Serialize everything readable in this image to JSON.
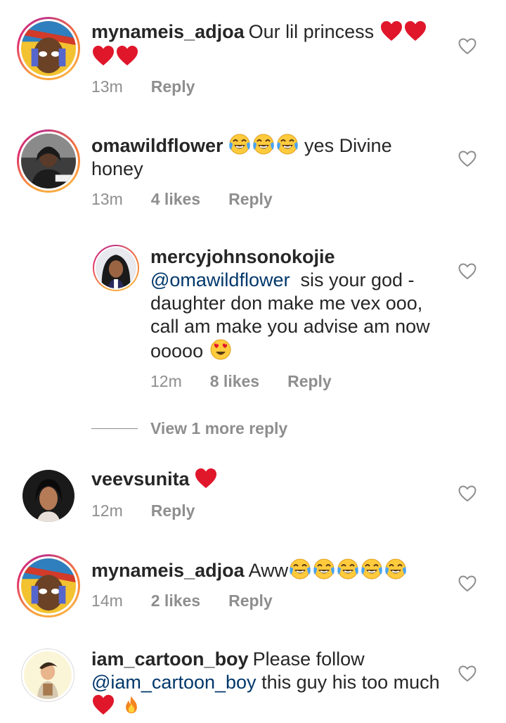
{
  "comments": [
    {
      "username": "mynameis_adjoa",
      "text": "Our lil princess",
      "time": "13m",
      "likes": "",
      "reply": "Reply"
    },
    {
      "username": "omawildflower",
      "text_after": "yes Divine honey",
      "time": "13m",
      "likes": "4 likes",
      "reply": "Reply"
    },
    {
      "username": "mercyjohnsonokojie",
      "mention": "@omawildflower",
      "text": "sis your god -daughter don make me vex ooo, call am make you advise am now ooooo",
      "time": "12m",
      "likes": "8 likes",
      "reply": "Reply"
    },
    {
      "username": "veevsunita",
      "time": "12m",
      "likes": "",
      "reply": "Reply"
    },
    {
      "username": "mynameis_adjoa",
      "text": "Aww",
      "time": "14m",
      "likes": "2 likes",
      "reply": "Reply"
    },
    {
      "username": "iam_cartoon_boy",
      "text": "Please follow",
      "mention": "@iam_cartoon_boy",
      "text_after": "this guy his too much",
      "time": "",
      "likes": "",
      "reply": ""
    }
  ],
  "view_more": "View 1 more reply",
  "colors": {
    "text": "#262626",
    "meta": "#8e8e8e",
    "mention": "#00376b",
    "heart": "#e0162b"
  },
  "icons": [
    "heart-outline-icon",
    "red-heart-emoji",
    "tears-of-joy-emoji",
    "heart-eyes-emoji",
    "fire-emoji"
  ]
}
